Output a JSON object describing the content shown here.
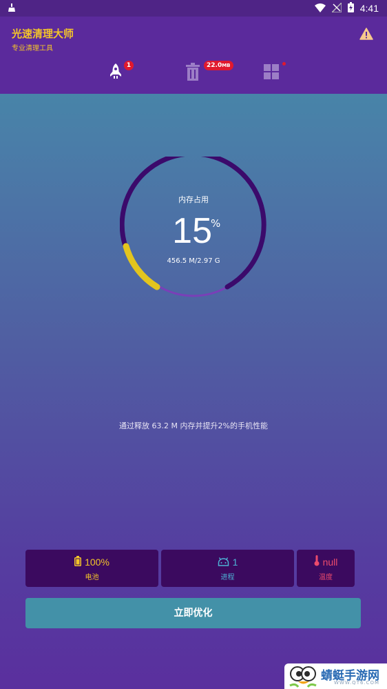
{
  "status_bar": {
    "time": "4:41",
    "icons": [
      "cleaner-notification-icon",
      "wifi-icon",
      "no-signal-icon",
      "battery-charging-icon"
    ]
  },
  "header": {
    "title": "光速清理大师",
    "subtitle": "专业清理工具",
    "accent_color": "#f3c42a",
    "background": "#5b2a9c"
  },
  "tabs": [
    {
      "icon": "rocket-icon",
      "badge": "1",
      "selected": true
    },
    {
      "icon": "trash-icon",
      "badge_value": "22.0",
      "badge_unit": "MB",
      "selected": false
    },
    {
      "icon": "grid-icon",
      "dot": true,
      "selected": false
    }
  ],
  "gauge": {
    "label": "内存占用",
    "value": "15",
    "unit": "%",
    "detail": "456.5 M/2.97 G",
    "fraction": 0.15,
    "track_color": "#3b0a6b",
    "fill_color": "#e3c51e"
  },
  "hint": "通过释放 63.2 M 内存并提升2%的手机性能",
  "stats": {
    "battery": {
      "value": "100%",
      "label": "电池",
      "icon": "battery-icon",
      "color": "#f3c42a"
    },
    "process": {
      "value": "1",
      "label": "进程",
      "icon": "android-icon",
      "color": "#4db3d6"
    },
    "temperature": {
      "value": "null",
      "label": "温度",
      "icon": "thermometer-icon",
      "color": "#ec4b6c"
    }
  },
  "optimize_button": "立即优化",
  "watermark": {
    "text": "蜻蜓手游网",
    "url": "WWW.QT6.COM"
  }
}
